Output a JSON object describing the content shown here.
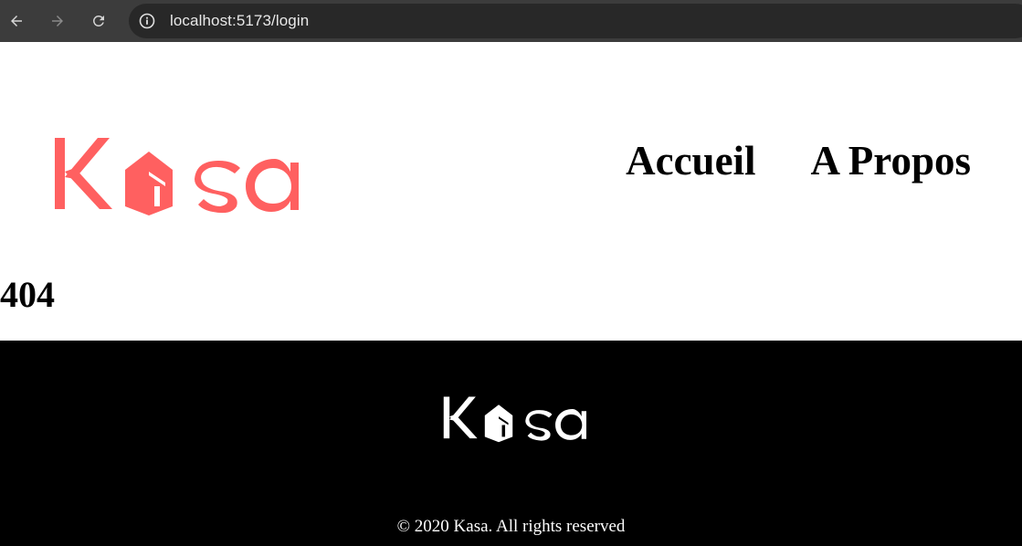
{
  "browser": {
    "url": "localhost:5173/login",
    "icons": [
      "back-arrow-icon",
      "forward-arrow-icon",
      "reload-icon",
      "info-icon"
    ]
  },
  "header": {
    "logo_text": "Kasa",
    "nav": [
      {
        "label": "Accueil"
      },
      {
        "label": "A Propos"
      }
    ]
  },
  "main": {
    "error_code": "404"
  },
  "footer": {
    "logo_text": "Kasa",
    "copyright": "© 2020 Kasa. All rights reserved"
  },
  "colors": {
    "brand": "#FF6060",
    "footer_bg": "#000000",
    "chrome_bg": "#3c3c3c"
  }
}
